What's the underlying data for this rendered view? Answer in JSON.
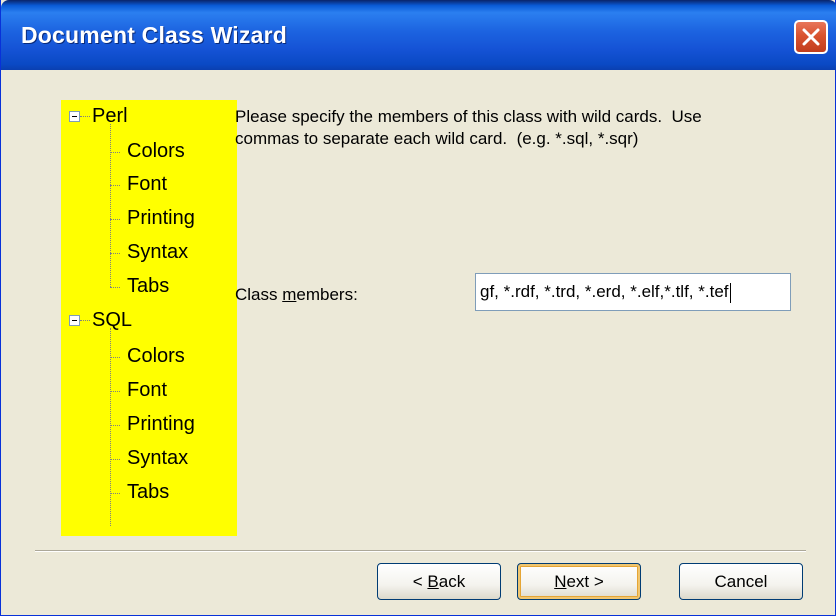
{
  "window": {
    "title": "Document Class Wizard",
    "close_icon": "close-icon"
  },
  "tree": {
    "background": "#ffff00",
    "groups": [
      {
        "label": "Perl",
        "expanded": true,
        "children": [
          "Colors",
          "Font",
          "Printing",
          "Syntax",
          "Tabs"
        ]
      },
      {
        "label": "SQL",
        "expanded": true,
        "children": [
          "Colors",
          "Font",
          "Printing",
          "Syntax",
          "Tabs"
        ]
      }
    ]
  },
  "instructions": {
    "line1": "Please specify the members of this class with wild cards.  Use",
    "line2": "commas to separate each wild card.  (e.g. *.sql, *.sqr)"
  },
  "class_members": {
    "label_before": "Class ",
    "label_accel": "m",
    "label_after": "embers:",
    "value": "gf, *.rdf, *.trd, *.erd, *.elf,*.tlf, *.tef"
  },
  "buttons": {
    "back_accel": "B",
    "back_rest": "ack",
    "back_prefix": "< ",
    "next_accel": "N",
    "next_rest": "ext >",
    "cancel": "Cancel"
  }
}
